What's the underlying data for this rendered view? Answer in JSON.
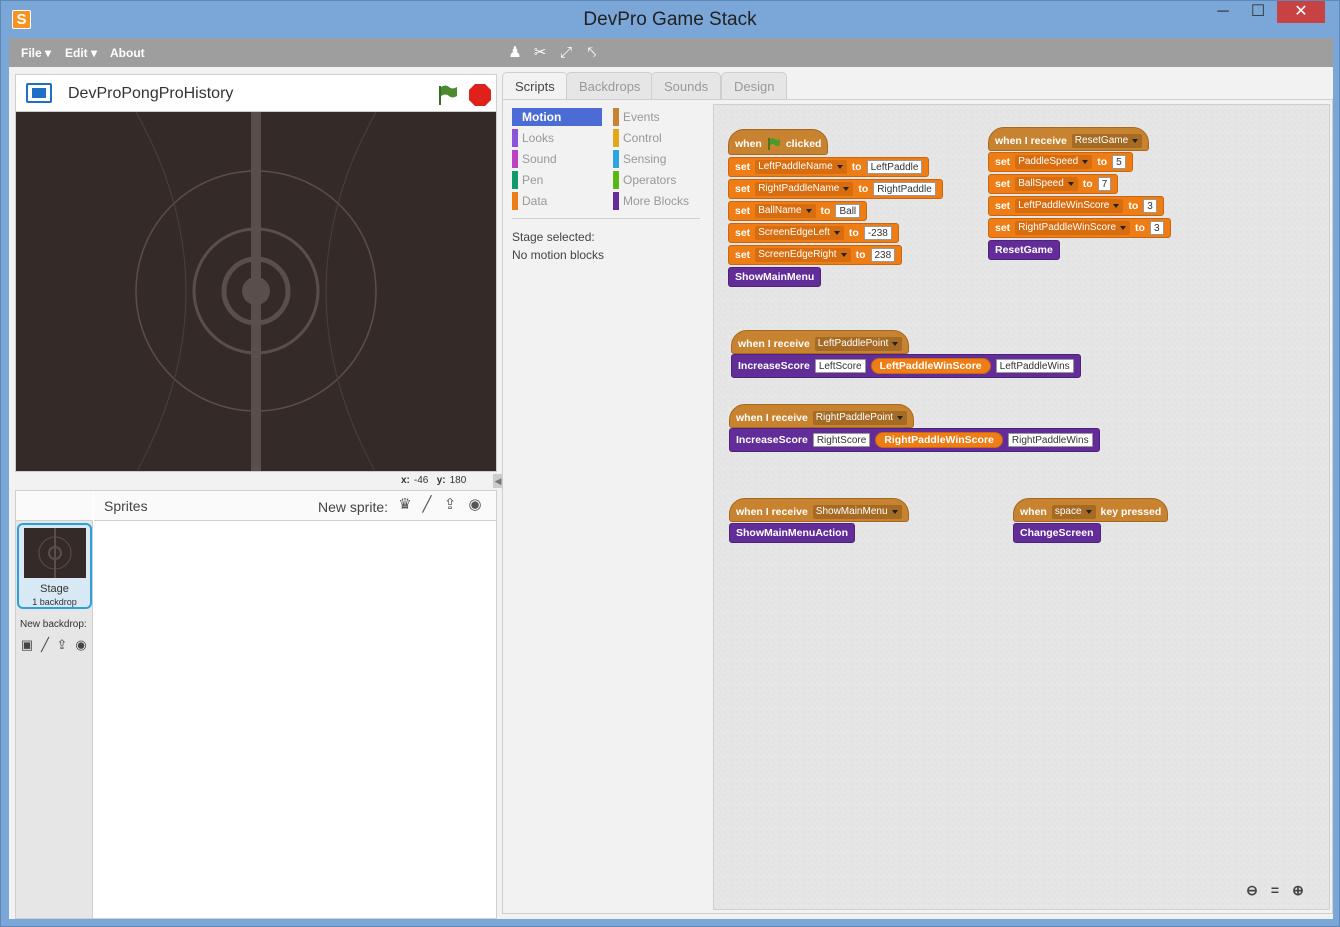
{
  "window": {
    "title": "DevPro Game Stack",
    "app_icon": "S"
  },
  "menu": {
    "file": "File",
    "edit": "Edit",
    "about": "About"
  },
  "toolbar": {
    "icons": [
      "duplicate-icon",
      "cut-icon",
      "grow-icon",
      "shrink-icon"
    ]
  },
  "project": {
    "name": "DevProPongProHistory"
  },
  "stage": {
    "coords": {
      "x_label": "x:",
      "x": "-46",
      "y_label": "y:",
      "y": "180"
    }
  },
  "sprites": {
    "title": "Sprites",
    "new_sprite": "New sprite:",
    "stage_label": "Stage",
    "stage_backdrops": "1 backdrop",
    "new_backdrop": "New backdrop:"
  },
  "tabs": [
    "Scripts",
    "Backdrops",
    "Sounds",
    "Design"
  ],
  "palette": {
    "categories": [
      {
        "label": "Motion",
        "color": "#4a6cd4"
      },
      {
        "label": "Looks",
        "color": "#8a55d7"
      },
      {
        "label": "Sound",
        "color": "#bb42c3"
      },
      {
        "label": "Pen",
        "color": "#0e9a6c"
      },
      {
        "label": "Data",
        "color": "#ee7d16"
      },
      {
        "label": "Events",
        "color": "#c88330"
      },
      {
        "label": "Control",
        "color": "#e1a91a"
      },
      {
        "label": "Sensing",
        "color": "#2ca5e2"
      },
      {
        "label": "Operators",
        "color": "#5cb712"
      },
      {
        "label": "More Blocks",
        "color": "#632d99"
      }
    ],
    "stage_selected": "Stage selected:",
    "no_blocks": "No motion blocks"
  },
  "scripts": {
    "s1": {
      "when": "when",
      "clicked": "clicked",
      "rows": [
        {
          "set": "set",
          "var": "LeftPaddleName",
          "to": "to",
          "val": "LeftPaddle"
        },
        {
          "set": "set",
          "var": "RightPaddleName",
          "to": "to",
          "val": "RightPaddle"
        },
        {
          "set": "set",
          "var": "BallName",
          "to": "to",
          "val": "Ball"
        },
        {
          "set": "set",
          "var": "ScreenEdgeLeft",
          "to": "to",
          "val": "-238"
        },
        {
          "set": "set",
          "var": "ScreenEdgeRight",
          "to": "to",
          "val": "238"
        }
      ],
      "call": "ShowMainMenu"
    },
    "s2": {
      "hat": "when I receive",
      "msg": "ResetGame",
      "rows": [
        {
          "set": "set",
          "var": "PaddleSpeed",
          "to": "to",
          "val": "5"
        },
        {
          "set": "set",
          "var": "BallSpeed",
          "to": "to",
          "val": "7"
        },
        {
          "set": "set",
          "var": "LeftPaddleWinScore",
          "to": "to",
          "val": "3"
        },
        {
          "set": "set",
          "var": "RightPaddleWinScore",
          "to": "to",
          "val": "3"
        }
      ],
      "call": "ResetGame"
    },
    "s3": {
      "hat": "when I receive",
      "msg": "LeftPaddlePoint",
      "call": "IncreaseScore",
      "a1": "LeftScore",
      "a2": "LeftPaddleWinScore",
      "a3": "LeftPaddleWins"
    },
    "s4": {
      "hat": "when I receive",
      "msg": "RightPaddlePoint",
      "call": "IncreaseScore",
      "a1": "RightScore",
      "a2": "RightPaddleWinScore",
      "a3": "RightPaddleWins"
    },
    "s5": {
      "hat": "when I receive",
      "msg": "ShowMainMenu",
      "call": "ShowMainMenuAction"
    },
    "s6": {
      "when": "when",
      "key": "space",
      "pressed": "key pressed",
      "call": "ChangeScreen"
    }
  },
  "zoom": {
    "out": "zoom-out-icon",
    "reset": "zoom-reset-icon",
    "in": "zoom-in-icon"
  }
}
